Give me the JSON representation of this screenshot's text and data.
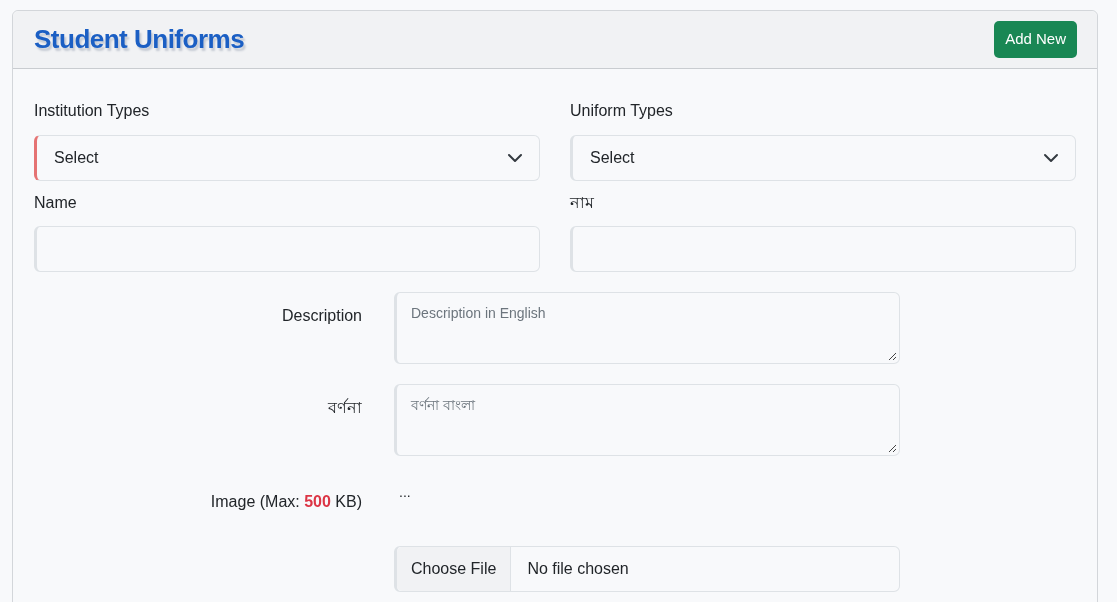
{
  "header": {
    "title": "Student Uniforms",
    "add_button": "Add New"
  },
  "selects": [
    {
      "label": "Institution Types",
      "value": "Select",
      "invalid": true
    },
    {
      "label": "Uniform Types",
      "value": "Select",
      "invalid": false
    }
  ],
  "name_fields": [
    {
      "label": "Name"
    },
    {
      "label": "নাম"
    }
  ],
  "descriptions": [
    {
      "label": "Description",
      "placeholder": "Description in English"
    },
    {
      "label": "বর্ণনা",
      "placeholder": "বর্ণনা বাংলা"
    }
  ],
  "image": {
    "label": "Image (Max: **500** KB)",
    "preview": "...",
    "choose_button": "Choose File",
    "file_status": "No file chosen"
  }
}
